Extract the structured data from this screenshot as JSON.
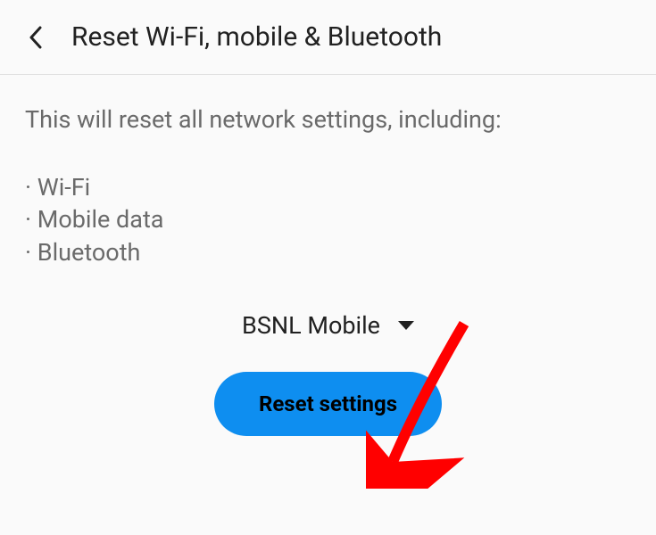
{
  "header": {
    "title": "Reset Wi-Fi, mobile & Bluetooth"
  },
  "content": {
    "description": "This will reset all network settings, including:",
    "bullets": {
      "item0": "· Wi-Fi",
      "item1": "· Mobile data",
      "item2": "· Bluetooth"
    }
  },
  "dropdown": {
    "selected": "BSNL Mobile"
  },
  "button": {
    "label": "Reset settings"
  }
}
